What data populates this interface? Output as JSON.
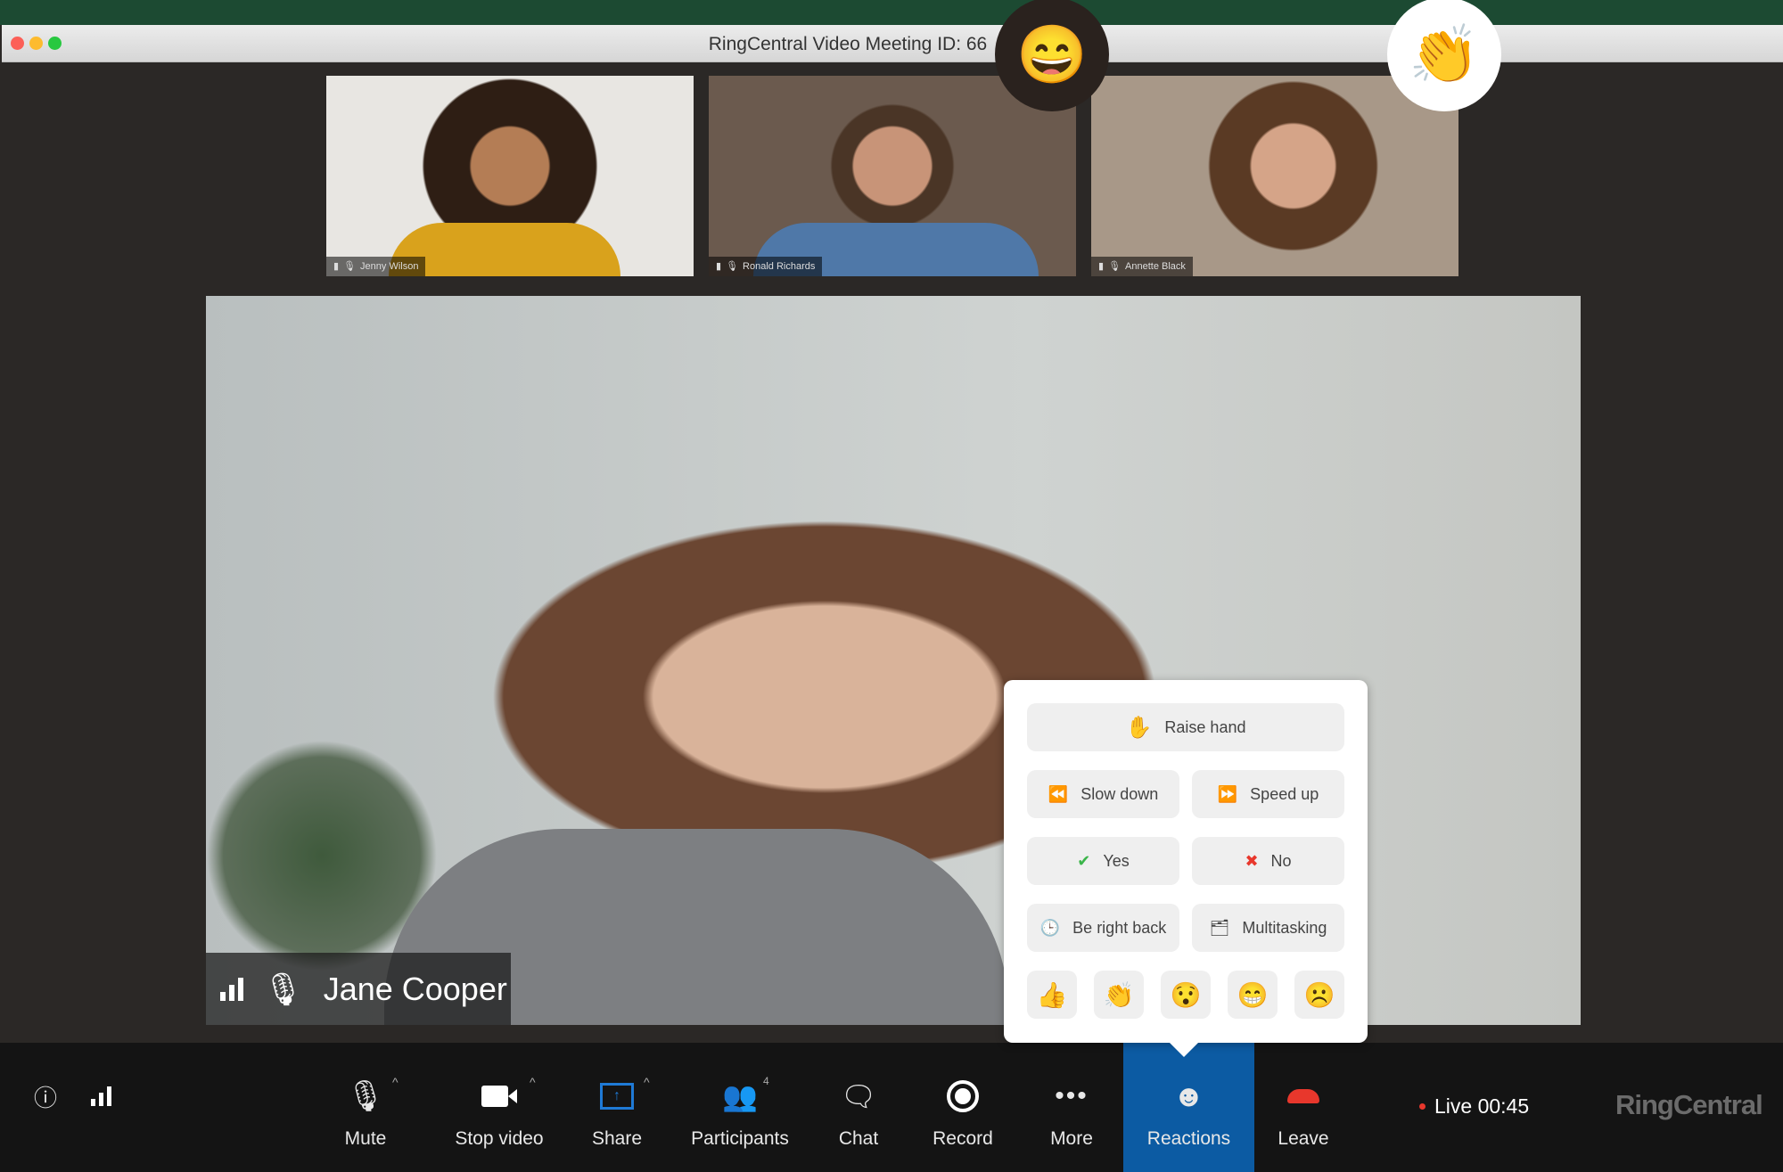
{
  "window": {
    "title": "RingCentral Video Meeting ID: 66"
  },
  "thumbnails": [
    {
      "name": "Jenny Wilson",
      "bg": "#c9a46a"
    },
    {
      "name": "Ronald Richards",
      "bg": "#5a4a3e"
    },
    {
      "name": "Annette Black",
      "bg": "#8a7868"
    }
  ],
  "main_video": {
    "name": "Jane Cooper"
  },
  "floating_reactions": [
    {
      "emoji": "😄"
    },
    {
      "emoji": "👏"
    }
  ],
  "reactions_panel": {
    "raise_hand": {
      "icon": "✋",
      "label": "Raise hand"
    },
    "slow_down": {
      "icon": "⏪",
      "label": "Slow down"
    },
    "speed_up": {
      "icon": "⏩",
      "label": "Speed up"
    },
    "yes": {
      "icon": "✔",
      "label": "Yes"
    },
    "no": {
      "icon": "✖",
      "label": "No"
    },
    "be_right_back": {
      "icon": "🕒",
      "label": "Be right back"
    },
    "multitasking": {
      "icon": "🗂",
      "label": "Multitasking"
    },
    "emojis": [
      "👍",
      "👏",
      "😯",
      "😁",
      "☹️"
    ]
  },
  "toolbar": {
    "mute": "Mute",
    "stop_video": "Stop video",
    "share": "Share",
    "participants": "Participants",
    "participants_count": "4",
    "chat": "Chat",
    "record": "Record",
    "more": "More",
    "reactions": "Reactions",
    "leave": "Leave",
    "live": "Live 00:45",
    "brand": "RingCentral"
  },
  "colors": {
    "accent": "#0c5ba3",
    "leave": "#e8372c",
    "live_dot": "#e8372c"
  }
}
